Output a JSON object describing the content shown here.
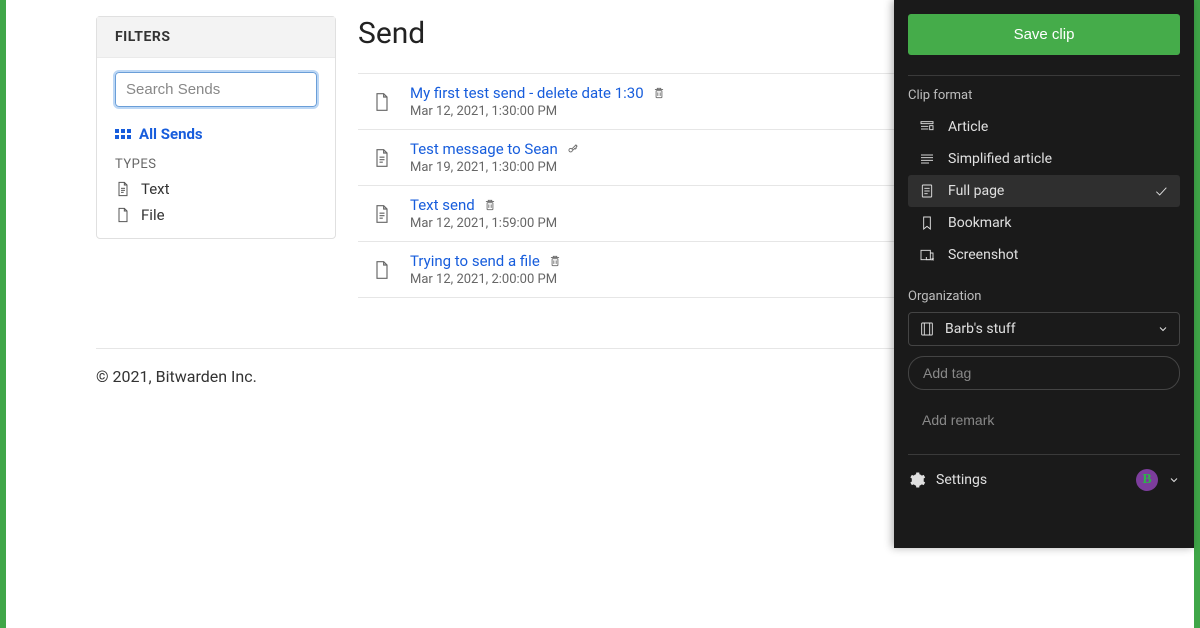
{
  "filters": {
    "header": "FILTERS",
    "search_placeholder": "Search Sends",
    "all_sends_label": "All Sends",
    "types_label": "TYPES",
    "types": [
      {
        "label": "Text",
        "icon": "text"
      },
      {
        "label": "File",
        "icon": "file"
      }
    ]
  },
  "main": {
    "title": "Send",
    "items": [
      {
        "title": "My first test send - delete date 1:30",
        "date": "Mar 12, 2021, 1:30:00 PM",
        "icon": "file",
        "trailing": "trash"
      },
      {
        "title": "Test message to Sean",
        "date": "Mar 19, 2021, 1:30:00 PM",
        "icon": "text",
        "trailing": "key"
      },
      {
        "title": "Text send",
        "date": "Mar 12, 2021, 1:59:00 PM",
        "icon": "text",
        "trailing": "trash"
      },
      {
        "title": "Trying to send a file",
        "date": "Mar 12, 2021, 2:00:00 PM",
        "icon": "file",
        "trailing": "trash"
      }
    ]
  },
  "footer": {
    "copyright": "© 2021, Bitwarden Inc."
  },
  "clipper": {
    "save_label": "Save clip",
    "format_label": "Clip format",
    "formats": [
      {
        "label": "Article",
        "icon": "article",
        "selected": false
      },
      {
        "label": "Simplified article",
        "icon": "lines",
        "selected": false
      },
      {
        "label": "Full page",
        "icon": "page",
        "selected": true
      },
      {
        "label": "Bookmark",
        "icon": "bookmark",
        "selected": false
      },
      {
        "label": "Screenshot",
        "icon": "screenshot",
        "selected": false
      }
    ],
    "organization_label": "Organization",
    "organization_value": "Barb's stuff",
    "tag_placeholder": "Add tag",
    "remark_placeholder": "Add remark",
    "settings_label": "Settings",
    "avatar_initial": "B"
  }
}
